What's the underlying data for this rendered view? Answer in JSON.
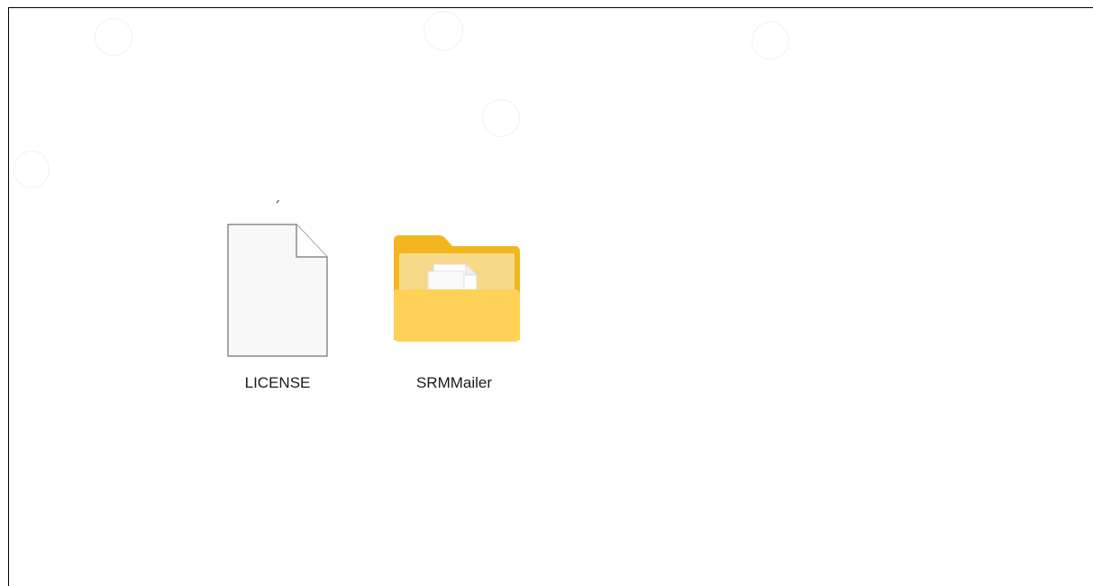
{
  "desktop": {
    "items": [
      {
        "name": "LICENSE",
        "type": "file",
        "icon": "blank-document-icon"
      },
      {
        "name": "SRMMailer",
        "type": "folder",
        "icon": "folder-with-documents-icon"
      }
    ]
  },
  "colors": {
    "background": "#ffffff",
    "folder_back": "#f3b61f",
    "folder_front": "#ffd257",
    "document_outline": "#8a8a8a",
    "document_fill": "#f8f8f8",
    "label_text": "#1a1a1a"
  }
}
